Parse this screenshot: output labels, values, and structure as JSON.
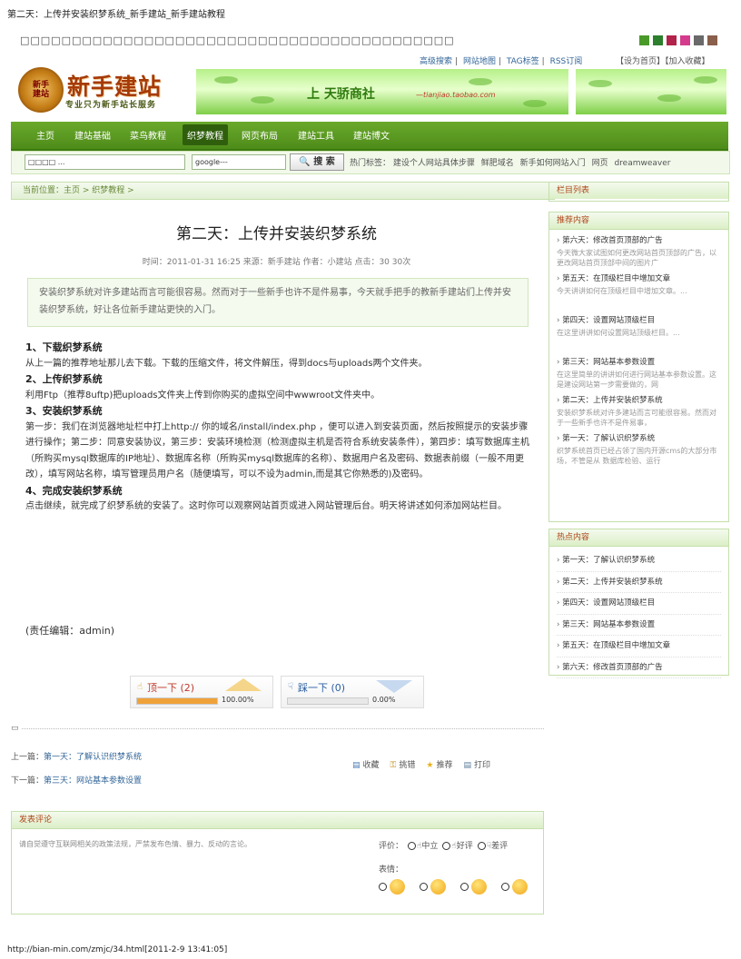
{
  "print": {
    "title": "第二天：上传并安装织梦系统_新手建站_新手建站教程",
    "url": "http://bian-min.com/zmjc/34.html[2011-2-9 13:41:05]"
  },
  "top": {
    "strip": "□□□□□□□□□□□□□□□□□□□□□□□□□□□□□□□□□□□□□□□□□□",
    "swatches": [
      "#4a9a2a",
      "#2c7f2c",
      "#b1234a",
      "#d43b8c",
      "#6a6a6a",
      "#8a5f4c"
    ],
    "links": [
      "高级搜索",
      "网站地图",
      "TAG标签",
      "RSS订阅"
    ],
    "fav": "【设为首页】【加入收藏】"
  },
  "logo": {
    "badge": "新手\n建站",
    "text": "新手建站",
    "slogan": "专业只为新手站长服务"
  },
  "banner": {
    "text": "上 天骄商社",
    "sub": "—tianjiao.taobao.com"
  },
  "nav": {
    "items": [
      "主页",
      "建站基础",
      "菜鸟教程",
      "织梦教程",
      "网页布局",
      "建站工具",
      "建站博文"
    ],
    "active_index": 3
  },
  "search": {
    "input_value": "□□□□     ...",
    "engine": "google---",
    "button": "搜 索",
    "hot_label": "热门标签：",
    "hot_tags": [
      "建设个人网站具体步骤",
      "鲜肥域名",
      "新手如何网站入门",
      "网页",
      "dreamweaver"
    ]
  },
  "crumb": {
    "label": "当前位置：",
    "home": "主页",
    "sep": " > ",
    "section": "织梦教程",
    "tail": " >"
  },
  "article": {
    "title": "第二天：上传并安装织梦系统",
    "meta": "时间：2011-01-31 16:25 来源：新手建站   作者：小建站   点击：30 30次",
    "summary": "安装织梦系统对许多建站而言可能很容易。然而对于一些新手也许不是件易事，今天就手把手的教新手建站们上传并安装织梦系统，好让各位新手建站更快的入门。",
    "sections": [
      {
        "heading": "1、下载织梦系统",
        "body": "从上一篇的推荐地址那儿去下载。下载的压缩文件，将文件解压，得到docs与uploads两个文件夹。"
      },
      {
        "heading": "2、上传织梦系统",
        "body": "利用Ftp（推荐8uftp)把uploads文件夹上传到你购买的虚拟空间中wwwroot文件夹中。"
      },
      {
        "heading": "3、安装织梦系统",
        "body": "第一步：我们在浏览器地址栏中打上http:// 你的域名/install/index.php ，便可以进入到安装页面，然后按照提示的安装步骤进行操作；第二步：同意安装协议，第三步：安装环境检测（检测虚拟主机是否符合系统安装条件），第四步：填写数据库主机（所购买mysql数据库的IP地址）、数据库名称（所购买mysql数据库的名称）、数据用户名及密码、数据表前缀（一般不用更改），填写网站名称，填写管理员用户名（随便填写，可以不设为admin,而是其它你熟悉的)及密码。"
      },
      {
        "heading": "4、完成安装织梦系统",
        "body": "点击继续，就完成了织梦系统的安装了。这时你可以观察网站首页或进入网站管理后台。明天将讲述如何添加网站栏目。"
      }
    ],
    "editor": "(责任编辑：admin)"
  },
  "vote": {
    "up_label": "顶一下",
    "up_count": "(2)",
    "up_pct": "100.00%",
    "up_fraction": 1.0,
    "down_label": "踩一下",
    "down_count": "(0)",
    "down_pct": "0.00%",
    "down_fraction": 0.0
  },
  "prevnext": {
    "prev_label": "上一篇：",
    "prev": "第一天：了解认识织梦系统",
    "next_label": "下一篇：",
    "next": "第三天：网站基本参数设置"
  },
  "actions": [
    "收藏",
    "挑错",
    "推荐",
    "打印"
  ],
  "comment": {
    "title": "发表评论",
    "notice": "请自觉遵守互联网相关的政策法规，严禁发布色情、暴力、反动的言论。",
    "rating_label": "评价：",
    "ratings": [
      "中立",
      "好评",
      "差评"
    ],
    "face_label": "表情："
  },
  "sidebar": {
    "columns_title": "栏目列表",
    "recommend_title": "推荐内容",
    "recommend": [
      {
        "title": "第六天：修改首页顶部的广告",
        "desc": "今天微大家试图如何更改网站首页顶部的广告，以更改网站首页顶部中间的图片广"
      },
      {
        "title": "第五天：在顶级栏目中增加文章",
        "desc": "今天讲讲如何在顶级栏目中增加文章。..."
      },
      {
        "title": "第四天：设置网站顶级栏目",
        "desc": "在这里讲讲如何设置网站顶级栏目。..."
      },
      {
        "title": "第三天：网站基本参数设置",
        "desc": "在这里简单的讲讲如何进行网站基本参数设置。这是建设网站第一步需要做的，网"
      },
      {
        "title": "第二天：上传并安装织梦系统",
        "desc": "安装织梦系统对许多建站而言可能很容易。然而对于一些新手也许不是件易事，"
      },
      {
        "title": "第一天：了解认识织梦系统",
        "desc": "织梦系统首页已经占领了国内开源cms的大部分市场，不管是从 数据库检验、运行"
      }
    ],
    "hot_title": "热点内容",
    "hot": [
      "第一天：了解认识织梦系统",
      "第二天：上传并安装织梦系统",
      "第四天：设置网站顶级栏目",
      "第三天：网站基本参数设置",
      "第五天：在顶级栏目中增加文章",
      "第六天：修改首页顶部的广告"
    ]
  },
  "colors": {
    "nav_green": "#4e8c1a",
    "accent_orange": "#b0451a",
    "up_bar": "#f0a23a",
    "down_bar": "#7a9dc8"
  }
}
